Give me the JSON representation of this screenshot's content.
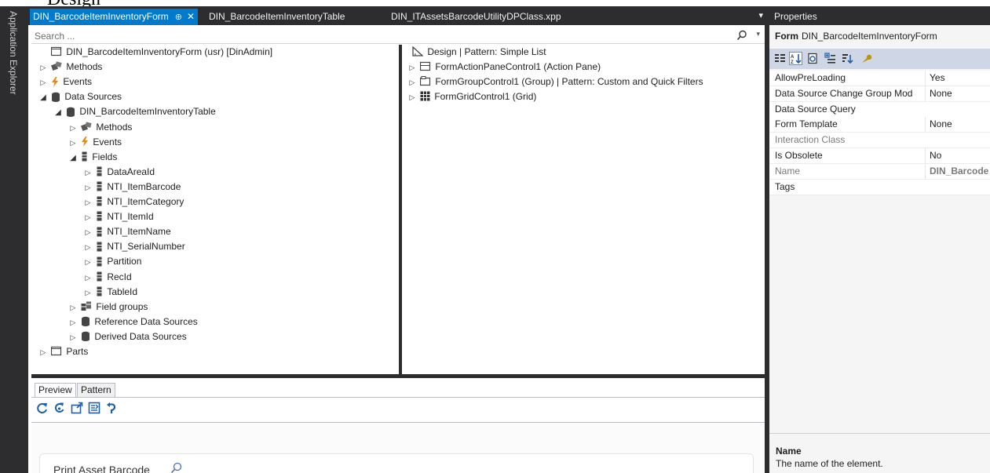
{
  "top_banner": {
    "text": "Design"
  },
  "side_strip": {
    "label": "Application Explorer"
  },
  "tabs": [
    {
      "label": "DIN_BarcodeItemInventoryForm",
      "pin": "⊕",
      "close": "✕"
    },
    {
      "label": "DIN_BarcodeItemInventoryTable"
    },
    {
      "label": "DIN_ITAssetsBarcodeUtilityDPClass.xpp"
    }
  ],
  "tab_dropdown": "▾",
  "search": {
    "placeholder": "Search ..."
  },
  "tree": [
    {
      "label": "DIN_BarcodeItemInventoryForm (usr) [DinAdmin]",
      "icon": "form-icon",
      "arrow": ""
    },
    {
      "label": "Methods",
      "icon": "methods-icon",
      "arrow": "▷"
    },
    {
      "label": "Events",
      "icon": "events-icon",
      "arrow": "▷"
    },
    {
      "label": "Data Sources",
      "icon": "datasource-icon",
      "arrow": "◢"
    },
    {
      "label": "DIN_BarcodeItemInventoryTable",
      "icon": "datasource-icon",
      "arrow": "◢"
    },
    {
      "label": "Methods",
      "icon": "methods-icon",
      "arrow": "▷"
    },
    {
      "label": "Events",
      "icon": "events-icon",
      "arrow": "▷"
    },
    {
      "label": "Fields",
      "icon": "field-icon",
      "arrow": "◢"
    },
    {
      "label": "DataAreaId",
      "icon": "field-icon",
      "arrow": "▷"
    },
    {
      "label": "NTI_ItemBarcode",
      "icon": "field-icon",
      "arrow": "▷"
    },
    {
      "label": "NTI_ItemCategory",
      "icon": "field-icon",
      "arrow": "▷"
    },
    {
      "label": "NTI_ItemId",
      "icon": "field-icon",
      "arrow": "▷"
    },
    {
      "label": "NTI_ItemName",
      "icon": "field-icon",
      "arrow": "▷"
    },
    {
      "label": "NTI_SerialNumber",
      "icon": "field-icon",
      "arrow": "▷"
    },
    {
      "label": "Partition",
      "icon": "field-icon",
      "arrow": "▷"
    },
    {
      "label": "RecId",
      "icon": "field-icon",
      "arrow": "▷"
    },
    {
      "label": "TableId",
      "icon": "field-icon",
      "arrow": "▷"
    },
    {
      "label": "Field groups",
      "icon": "field-group-icon",
      "arrow": "▷"
    },
    {
      "label": "Reference Data Sources",
      "icon": "datasource-icon",
      "arrow": "▷"
    },
    {
      "label": "Derived Data Sources",
      "icon": "datasource-icon",
      "arrow": "▷"
    },
    {
      "label": "Parts",
      "icon": "form-icon",
      "arrow": "▷"
    }
  ],
  "design": [
    {
      "label": "Design | Pattern: Simple List",
      "arrow": ""
    },
    {
      "label": "FormActionPaneControl1 (Action Pane)",
      "arrow": "▷"
    },
    {
      "label": "FormGroupControl1 (Group) | Pattern: Custom and Quick Filters",
      "arrow": "▷"
    },
    {
      "label": "FormGridControl1 (Grid)",
      "arrow": "▷"
    }
  ],
  "preview": {
    "tabs": [
      "Preview",
      "Pattern"
    ],
    "card_label": "Print Asset Barcode"
  },
  "properties": {
    "header": "Properties",
    "object_kind": "Form",
    "object_name": "DIN_BarcodeItemInventoryForm",
    "rows": [
      {
        "name": "AllowPreLoading",
        "value": "Yes"
      },
      {
        "name": "Data Source Change Group Mod",
        "value": "None"
      },
      {
        "name": "Data Source Query",
        "value": ""
      },
      {
        "name": "Form Template",
        "value": "None"
      },
      {
        "name": "Interaction Class",
        "value": ""
      },
      {
        "name": "Is Obsolete",
        "value": "No"
      },
      {
        "name": "Name",
        "value": "DIN_Barcode"
      },
      {
        "name": "Tags",
        "value": ""
      }
    ],
    "desc_title": "Name",
    "desc_text": "The name of the element."
  },
  "colors": {
    "chrome_dark": "#2d2d30",
    "active_tab": "#007acc",
    "props_toolbar": "#cfd6e5",
    "events_orange": "#e8860c"
  }
}
